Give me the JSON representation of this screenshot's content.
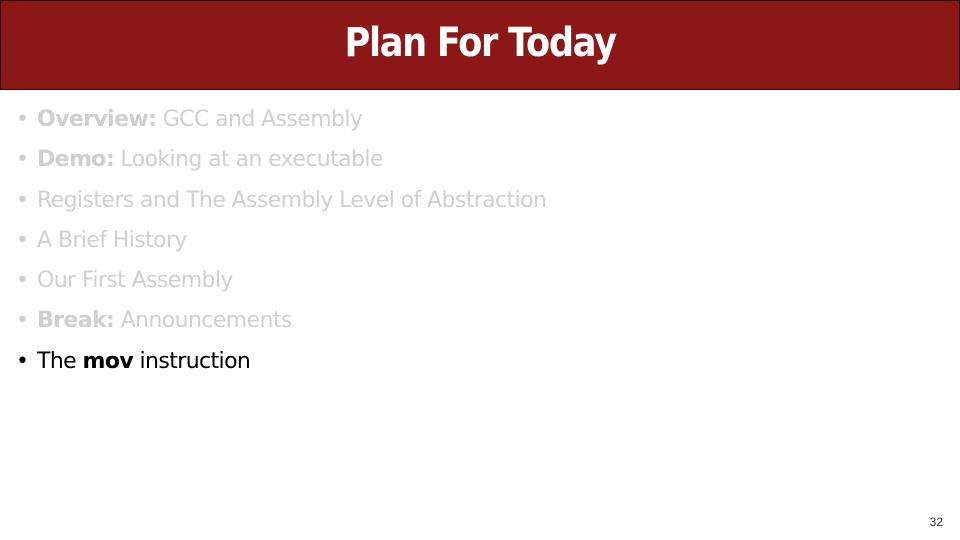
{
  "slide": {
    "title": "Plan For Today",
    "page_number": "32",
    "colors": {
      "header_bg": "#8b1717",
      "title_text": "#ffffff",
      "dimmed_text": "#d0d0d0",
      "active_text": "#000000"
    },
    "bullet_glyph": "•",
    "items": [
      {
        "bold": "Overview:",
        "text": " GCC and Assembly",
        "state": "dimmed"
      },
      {
        "bold": "Demo:",
        "text": " Looking at an executable",
        "state": "dimmed"
      },
      {
        "bold": "",
        "text": "Registers and The Assembly Level of Abstraction",
        "state": "dimmed"
      },
      {
        "bold": "",
        "text": "A Brief History",
        "state": "dimmed"
      },
      {
        "bold": "",
        "text": "Our First Assembly",
        "state": "dimmed"
      },
      {
        "bold": "Break:",
        "text": " Announcements",
        "state": "dimmed"
      },
      {
        "prefix": "The ",
        "bold": "mov",
        "text": " instruction",
        "state": "active"
      }
    ]
  }
}
